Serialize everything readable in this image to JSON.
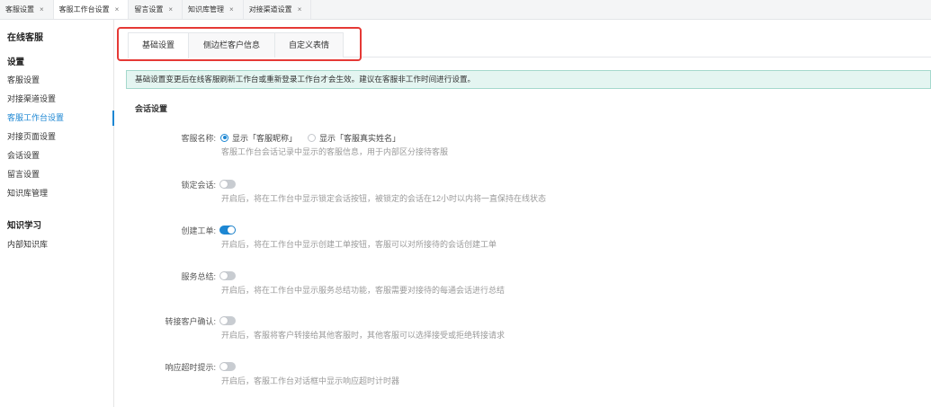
{
  "window_tabs": [
    {
      "label": "客服设置",
      "close": "×",
      "active": false
    },
    {
      "label": "客服工作台设置",
      "close": "×",
      "active": true
    },
    {
      "label": "留言设置",
      "close": "×",
      "active": false
    },
    {
      "label": "知识库管理",
      "close": "×",
      "active": false
    },
    {
      "label": "对接渠道设置",
      "close": "×",
      "active": false
    }
  ],
  "sidebar": {
    "title": "在线客服",
    "groups": [
      {
        "heading": "设置",
        "items": [
          {
            "label": "客服设置",
            "active": false
          },
          {
            "label": "对接渠道设置",
            "active": false
          },
          {
            "label": "客服工作台设置",
            "active": true
          },
          {
            "label": "对接页面设置",
            "active": false
          },
          {
            "label": "会话设置",
            "active": false
          },
          {
            "label": "留言设置",
            "active": false
          },
          {
            "label": "知识库管理",
            "active": false
          }
        ]
      },
      {
        "heading": "知识学习",
        "items": [
          {
            "label": "内部知识库",
            "active": false
          }
        ]
      }
    ]
  },
  "content_tabs": [
    {
      "label": "基础设置",
      "active": true
    },
    {
      "label": "侧边栏客户信息",
      "active": false
    },
    {
      "label": "自定义表情",
      "active": false
    }
  ],
  "notice": "基础设置变更后在线客服刷新工作台或重新登录工作台才会生效。建议在客服非工作时间进行设置。",
  "section_title": "会话设置",
  "settings": [
    {
      "label": "客服名称:",
      "options": [
        {
          "label": "显示「客服昵称」",
          "checked": true
        },
        {
          "label": "显示「客服真实姓名」",
          "checked": false
        }
      ],
      "help": "客服工作台会话记录中显示的客服信息，用于内部区分接待客服"
    },
    {
      "label": "锁定会话:",
      "enabled": false,
      "help": "开启后，将在工作台中显示锁定会话按钮，被锁定的会话在12小时以内将一直保持在线状态"
    },
    {
      "label": "创建工单:",
      "enabled": true,
      "help": "开启后，将在工作台中显示创建工单按钮，客服可以对所接待的会话创建工单"
    },
    {
      "label": "服务总结:",
      "enabled": false,
      "help": "开启后，将在工作台中显示服务总结功能，客服需要对接待的每通会话进行总结"
    },
    {
      "label": "转接客户确认:",
      "enabled": false,
      "help": "开启后，客服将客户转接给其他客服时，其他客服可以选择接受或拒绝转接请求"
    },
    {
      "label": "响应超时提示:",
      "enabled": false,
      "help": "开启后，客服工作台对话框中显示响应超时计时器"
    }
  ],
  "colors": {
    "accent": "#1d87d3",
    "annotation_box": "#e53935",
    "notice_background": "#e4f5f1",
    "notice_border": "#a5d9cd",
    "toggle_off": "#c8ccd1"
  }
}
